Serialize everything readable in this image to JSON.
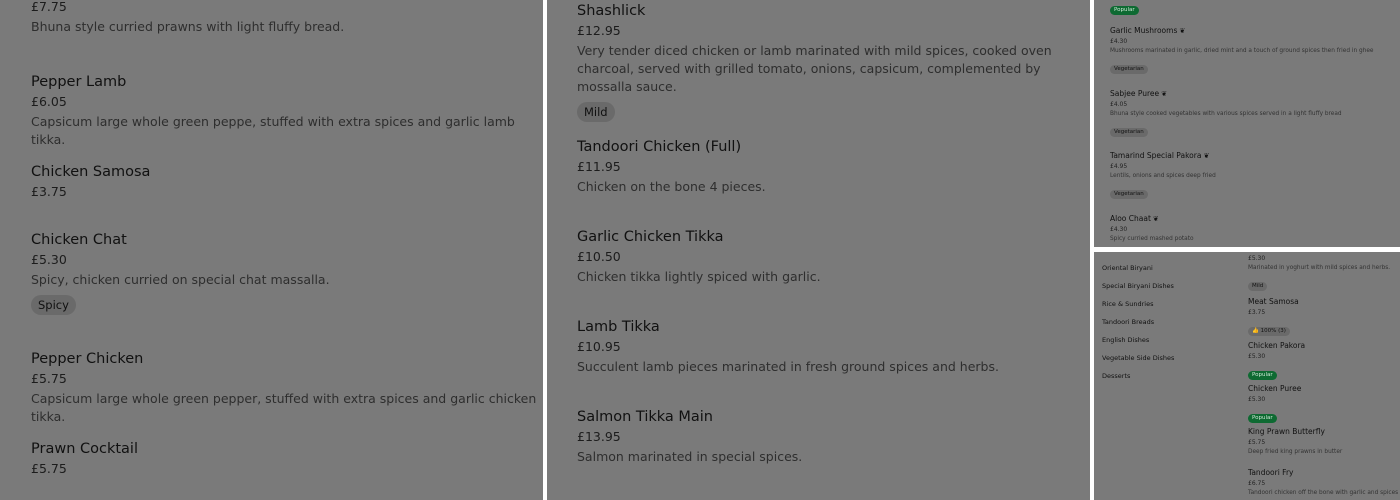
{
  "panel_a": {
    "top_price": "£7.75",
    "top_desc": "Bhuna style curried prawns with light fluffy bread.",
    "items": [
      {
        "name": "Pepper Lamb",
        "price": "£6.05",
        "desc": "Capsicum large whole green peppe, stuffed with extra spices and garlic lamb tikka."
      },
      {
        "name": "Chicken Samosa",
        "price": "£3.75"
      },
      {
        "name": "Chicken Chat",
        "price": "£5.30",
        "desc": "Spicy, chicken curried on special chat massalla.",
        "tag": "Spicy"
      },
      {
        "name": "Pepper Chicken",
        "price": "£5.75",
        "desc": "Capsicum large whole green pepper, stuffed with extra spices and garlic chicken tikka."
      },
      {
        "name": "Prawn Cocktail",
        "price": "£5.75"
      }
    ]
  },
  "panel_b": {
    "items": [
      {
        "name": "Shashlick",
        "price": "£12.95",
        "desc": "Very tender diced chicken or lamb marinated with mild spices, cooked oven charcoal, served with grilled tomato, onions, capsicum, complemented by mossalla sauce.",
        "tag": "Mild"
      },
      {
        "name": "Tandoori Chicken (Full)",
        "price": "£11.95",
        "desc": "Chicken on the bone 4 pieces."
      },
      {
        "name": "Garlic Chicken Tikka",
        "price": "£10.50",
        "desc": "Chicken tikka lightly spiced with garlic."
      },
      {
        "name": "Lamb Tikka",
        "price": "£10.95",
        "desc": "Succulent lamb pieces marinated in fresh ground spices and herbs."
      },
      {
        "name": "Salmon Tikka Main",
        "price": "£13.95",
        "desc": "Salmon marinated in special spices."
      }
    ]
  },
  "panel_c": {
    "top_tag": "Popular",
    "items": [
      {
        "name": "Garlic Mushrooms",
        "price": "£4.30",
        "desc": "Mushrooms marinated in garlic, dried mint and a touch of ground spices then fried in ghee",
        "tag": "Vegetarian"
      },
      {
        "name": "Sabjee Puree",
        "price": "£4.05",
        "desc": "Bhuna style cooked vegetables with various spices served in a light fluffy bread",
        "tag": "Vegetarian"
      },
      {
        "name": "Tamarind Special Pakora",
        "price": "£4.95",
        "desc": "Lentils, onions and spices deep fried",
        "tag": "Vegetarian"
      },
      {
        "name": "Aloo Chaat",
        "price": "£4.30",
        "desc": "Spicy curried mashed potato"
      }
    ],
    "leaf_icon": "leaf-icon"
  },
  "panel_d": {
    "categories": [
      "Oriental Biryani",
      "Special Biryani Dishes",
      "Rice & Sundries",
      "Tandoori Breads",
      "English Dishes",
      "Vegetable Side Dishes",
      "Desserts"
    ],
    "top_price": "£5.30",
    "top_desc": "Marinated in yoghurt with mild spices and herbs.",
    "top_tag": "Mild",
    "items": [
      {
        "name": "Meat Samosa",
        "price": "£3.75",
        "rating": "👍 100% (3)"
      },
      {
        "name": "Chicken Pakora",
        "price": "£5.30",
        "tag": "Popular"
      },
      {
        "name": "Chicken Puree",
        "price": "£5.30",
        "tag": "Popular"
      },
      {
        "name": "King Prawn Butterfly",
        "price": "£5.75",
        "desc": "Deep fried king prawns in butter"
      },
      {
        "name": "Tandoori Fry",
        "price": "£6.75",
        "desc": "Tandoori chicken off the bone with garlic and spices"
      }
    ]
  }
}
